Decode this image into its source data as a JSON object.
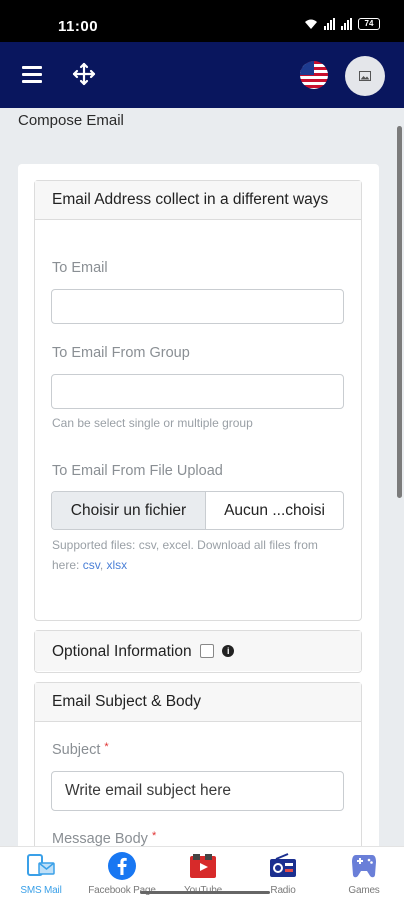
{
  "status_bar": {
    "time": "11:00",
    "battery": "74"
  },
  "page": {
    "title": "Compose Email"
  },
  "email_address_panel": {
    "heading": "Email Address collect in a different ways",
    "to_email_label": "To Email",
    "to_email_value": "",
    "group_label": "To Email From Group",
    "group_value": "",
    "group_help": "Can be select single or multiple group",
    "file_label": "To Email From File Upload",
    "file_button": "Choisir un fichier",
    "file_status": "Aucun ...choisi",
    "file_help": "Supported files: csv, excel. Download all files from here:",
    "csv_link": "csv",
    "xlsx_link": "xlsx",
    "link_separator": ","
  },
  "optional_panel": {
    "heading": "Optional Information",
    "info_glyph": "i"
  },
  "subject_panel": {
    "heading": "Email Subject & Body",
    "subject_label": "Subject",
    "subject_placeholder": "Write email subject here",
    "body_label": "Message Body",
    "required_mark": "*"
  },
  "bottom_nav": [
    {
      "label": "SMS Mail",
      "icon": "sms-mail-icon",
      "active": true
    },
    {
      "label": "Facebook Page",
      "icon": "facebook-icon",
      "active": false
    },
    {
      "label": "YouTube",
      "icon": "youtube-icon",
      "active": false
    },
    {
      "label": "Radio",
      "icon": "radio-icon",
      "active": false
    },
    {
      "label": "Games",
      "icon": "gamepad-icon",
      "active": false
    }
  ],
  "colors": {
    "navbar": "#09165e",
    "active_tab": "#3aa0e8",
    "link": "#4a7fd6",
    "required": "#e03131"
  }
}
